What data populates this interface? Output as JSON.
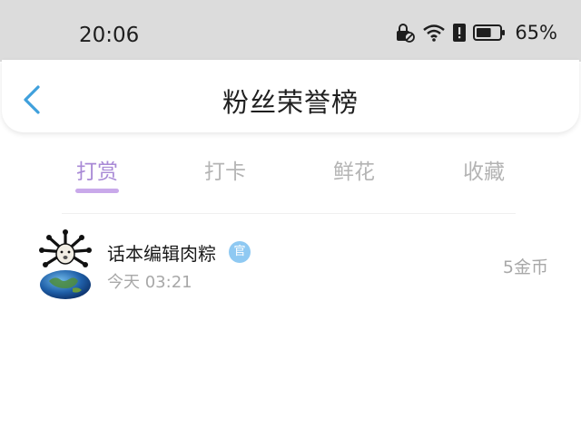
{
  "status_bar": {
    "time": "20:06",
    "battery_percent": "65%",
    "battery_level": 0.65,
    "icons": [
      "lock-icon",
      "wifi-icon",
      "alert-icon",
      "battery-icon"
    ]
  },
  "header": {
    "title": "粉丝荣誉榜",
    "back_icon": "chevron-left-icon",
    "accent_color": "#3fa0dc"
  },
  "tabs": [
    {
      "label": "打赏",
      "active": true
    },
    {
      "label": "打卡",
      "active": false
    },
    {
      "label": "鲜花",
      "active": false
    },
    {
      "label": "收藏",
      "active": false
    }
  ],
  "list": [
    {
      "name": "话本编辑肉粽",
      "badge": "官",
      "time": "今天 03:21",
      "amount": "5金币"
    }
  ],
  "colors": {
    "active_tab": "#a98ad6",
    "indicator": "#c9a9ea",
    "inactive_tab": "#b4b4b4",
    "badge": "#8fc9f2"
  }
}
